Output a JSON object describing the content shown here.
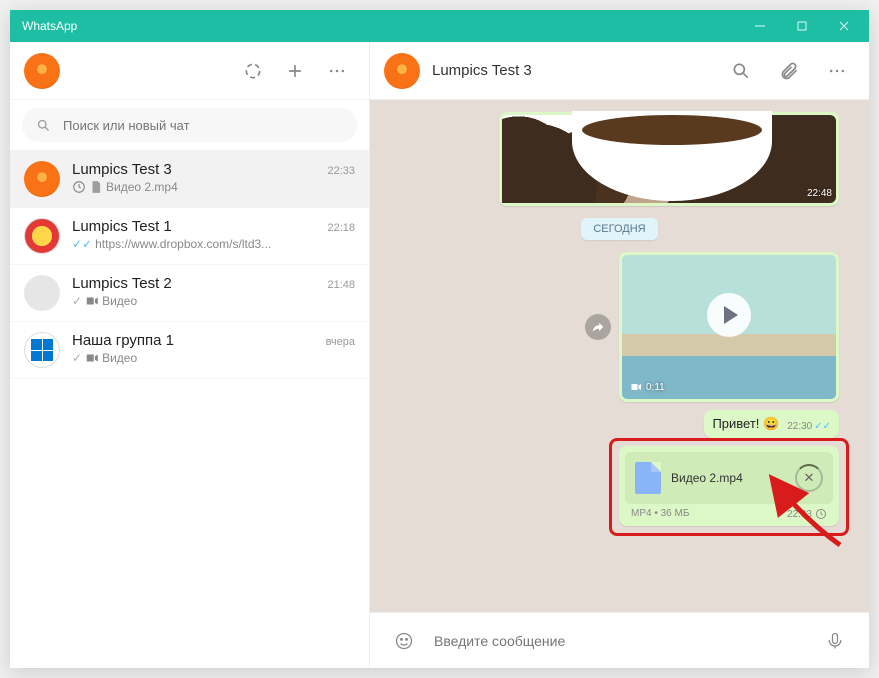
{
  "titlebar": {
    "title": "WhatsApp"
  },
  "sidebar": {
    "search_placeholder": "Поиск или новый чат",
    "chats": [
      {
        "name": "Lumpics Test 3",
        "time": "22:33",
        "preview": "Видео 2.mp4",
        "has_clock": true,
        "has_doc": true,
        "avatar": "orange",
        "active": true
      },
      {
        "name": "Lumpics Test 1",
        "time": "22:18",
        "preview": "https://www.dropbox.com/s/ltd3...",
        "ticks": "blue",
        "avatar": "redyellow"
      },
      {
        "name": "Lumpics Test 2",
        "time": "21:48",
        "preview": "Видео",
        "ticks": "gray",
        "has_cam": true,
        "avatar": "gray"
      },
      {
        "name": "Наша группа 1",
        "time": "вчера",
        "preview": "Видео",
        "ticks": "gray",
        "has_cam": true,
        "avatar": "win"
      }
    ]
  },
  "header": {
    "title": "Lumpics Test 3"
  },
  "messages": {
    "image": {
      "time": "22:48"
    },
    "date_chip": "СЕГОДНЯ",
    "video": {
      "duration": "0:11"
    },
    "text": {
      "content": "Привет! 😀",
      "time": "22:30"
    },
    "file": {
      "name": "Видео 2.mp4",
      "type": "MP4",
      "size": "36 МБ",
      "time": "22:33"
    }
  },
  "composer": {
    "placeholder": "Введите сообщение"
  }
}
